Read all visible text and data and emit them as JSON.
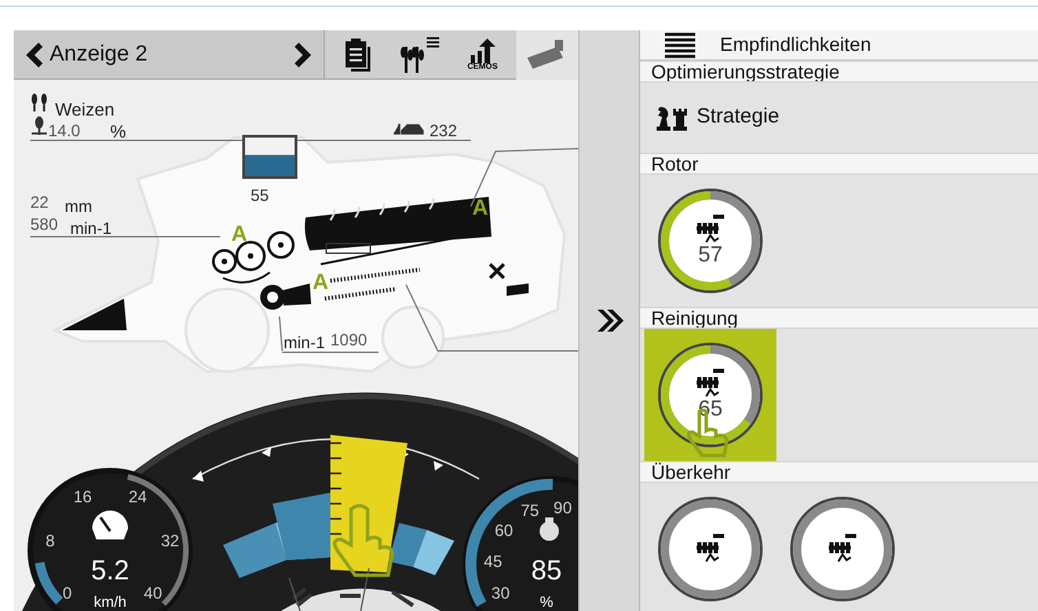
{
  "toolbar": {
    "title": "Anzeige 2",
    "cemos_label": "CEMOS"
  },
  "crop": {
    "name": "Weizen",
    "moisture": "14.0",
    "moisture_unit": "%"
  },
  "tank_counter": "232",
  "tank": {
    "reading": "55"
  },
  "settings": [
    {
      "value": "22",
      "unit": "mm"
    },
    {
      "value": "580",
      "unit": "min-1"
    }
  ],
  "fan": {
    "unit": "min-1",
    "value": "1090"
  },
  "auto_marks": [
    "A",
    "A",
    "A"
  ],
  "speed": {
    "ticks": [
      "0",
      "8",
      "16",
      "24",
      "32",
      "40"
    ],
    "value": "5.2",
    "unit": "km/h",
    "level": 0.13
  },
  "engine_load": {
    "ticks": [
      "90",
      "75",
      "60",
      "45",
      "30"
    ],
    "value": "85",
    "unit": "%",
    "level": 0.92
  },
  "panel": {
    "title": "Empfindlichkeiten",
    "sections": [
      {
        "label": "Optimierungsstrategie",
        "items": [
          {
            "kind": "button",
            "label": "Strategie"
          }
        ]
      },
      {
        "label": "Rotor",
        "items": [
          {
            "kind": "dial",
            "value": "57",
            "level": 0.57,
            "selected": false
          }
        ]
      },
      {
        "label": "Reinigung",
        "items": [
          {
            "kind": "dial",
            "value": "65",
            "level": 0.65,
            "selected": true
          }
        ]
      },
      {
        "label": "Überkehr",
        "items": [
          {
            "kind": "dial",
            "selected": false
          },
          {
            "kind": "dial",
            "selected": false
          }
        ]
      }
    ]
  }
}
